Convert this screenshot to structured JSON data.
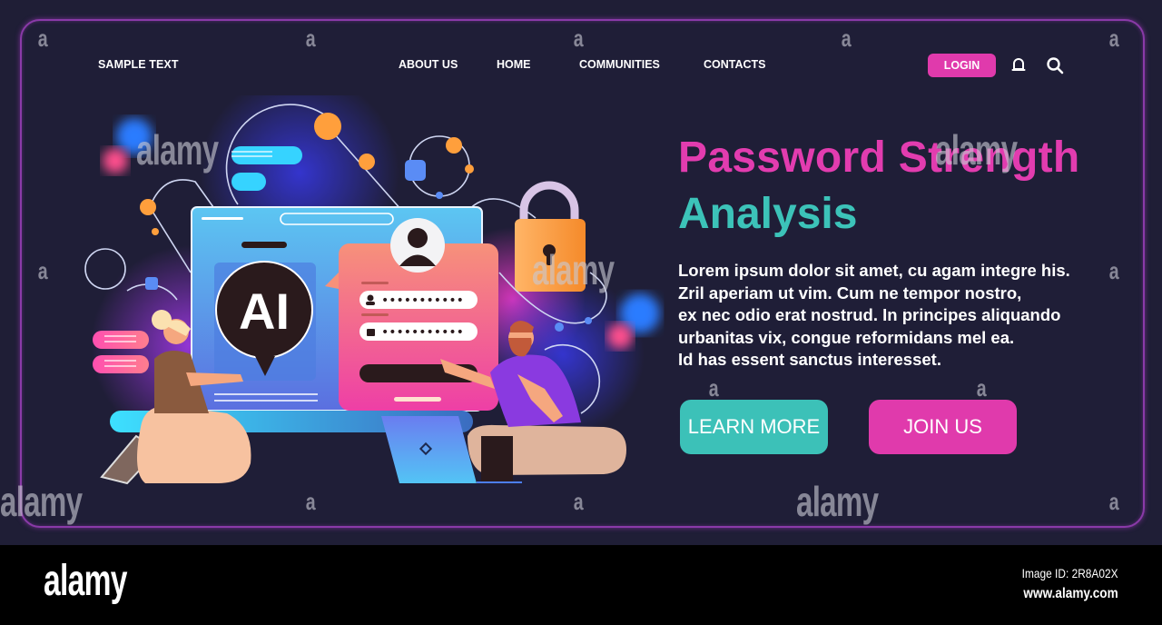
{
  "nav": {
    "brand": "SAMPLE TEXT",
    "links": [
      "ABOUT US",
      "HOME",
      "COMMUNITIES",
      "CONTACTS"
    ],
    "login_label": "LOGIN",
    "icons": [
      "bell-icon",
      "search-icon"
    ]
  },
  "hero": {
    "title_line1": "Password Strength",
    "title_line2": "Analysis",
    "description_lines": [
      "Lorem ipsum dolor sit amet, cu agam integre his.",
      "Zril aperiam ut vim. Cum ne tempor nostro,",
      "ex nec odio erat nostrud. In principes aliquando",
      "urbanitas vix, congue reformidans mel ea.",
      "Id has essent sanctus interesset."
    ],
    "learn_more_label": "LEARN MORE",
    "join_us_label": "JOIN US"
  },
  "illustration": {
    "ai_badge": "AI",
    "password_mask": "•••••••••••"
  },
  "watermark": {
    "mark": "a",
    "word": "alamy"
  },
  "footer": {
    "logo": "alamy",
    "image_id": "Image ID: 2R8A02X",
    "url": "www.alamy.com"
  },
  "colors": {
    "background": "#1f1e36",
    "accent_pink": "#e03aac",
    "accent_teal": "#3cc1b8",
    "frame_border": "#8a3aa8"
  }
}
